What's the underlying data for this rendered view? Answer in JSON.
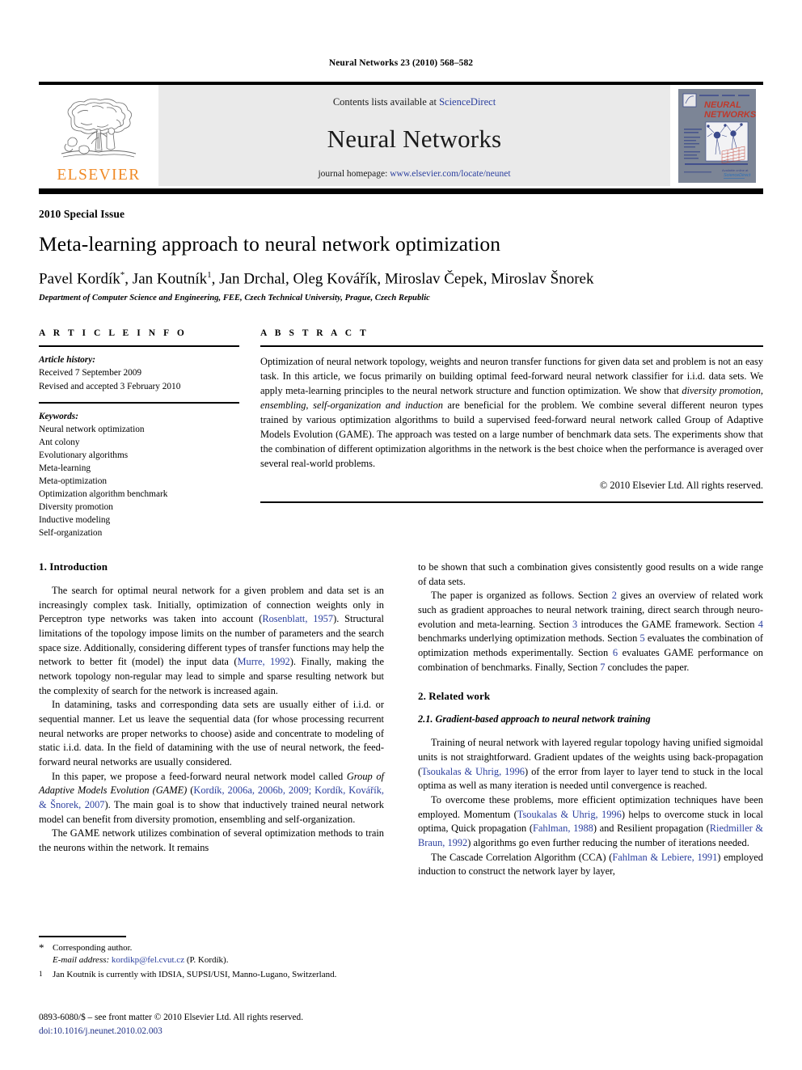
{
  "running_head": "Neural Networks 23 (2010) 568–582",
  "masthead": {
    "publisher_name": "ELSEVIER",
    "contents_prefix": "Contents lists available at ",
    "contents_link": "ScienceDirect",
    "journal_name": "Neural Networks",
    "homepage_prefix": "journal homepage: ",
    "homepage_url": "www.elsevier.com/locate/neunet",
    "cover_title_line1": "NEURAL",
    "cover_title_line2": "NETWORKS"
  },
  "title_block": {
    "special_issue": "2010 Special Issue",
    "title": "Meta-learning approach to neural network optimization",
    "affiliation": "Department of Computer Science and Engineering, FEE, Czech Technical University, Prague, Czech Republic"
  },
  "authors": [
    {
      "name": "Pavel Kordík",
      "mark": "*"
    },
    {
      "name": "Jan Koutník",
      "mark": "1"
    },
    {
      "name": "Jan Drchal",
      "mark": ""
    },
    {
      "name": "Oleg Kovářík",
      "mark": ""
    },
    {
      "name": "Miroslav Čepek",
      "mark": ""
    },
    {
      "name": "Miroslav Šnorek",
      "mark": ""
    }
  ],
  "article_info": {
    "label": "A R T I C L E    I N F O",
    "history_label": "Article history:",
    "history": [
      "Received 7 September 2009",
      "Revised and accepted 3 February 2010"
    ],
    "keywords_label": "Keywords:",
    "keywords": [
      "Neural network optimization",
      "Ant colony",
      "Evolutionary algorithms",
      "Meta-learning",
      "Meta-optimization",
      "Optimization algorithm benchmark",
      "Diversity promotion",
      "Inductive modeling",
      "Self-organization"
    ]
  },
  "abstract": {
    "label": "A B S T R A C T",
    "part1": "Optimization of neural network topology, weights and neuron transfer functions for given data set and problem is not an easy task. In this article, we focus primarily on building optimal feed-forward neural network classifier for i.i.d. data sets. We apply meta-learning principles to the neural network structure and function optimization. We show that ",
    "emphasis1": "diversity promotion, ensembling, self-organization and induction",
    "part2": " are beneficial for the problem. We combine several different neuron types trained by various optimization algorithms to build a supervised feed-forward neural network called Group of Adaptive Models Evolution (GAME). The approach was tested on a large number of benchmark data sets. The experiments show that the combination of different optimization algorithms in the network is the best choice when the performance is averaged over several real-world problems.",
    "copyright": "© 2010 Elsevier Ltd. All rights reserved."
  },
  "sections": {
    "introduction_heading": "1. Introduction",
    "intro_p1_a": "The search for optimal neural network for a given problem and data set is an increasingly complex task. Initially, optimization of connection weights only in Perceptron type networks was taken into account (",
    "intro_p1_cite1": "Rosenblatt, 1957",
    "intro_p1_b": "). Structural limitations of the topology impose limits on the number of parameters and the search space size. Additionally, considering different types of transfer functions may help the network to better fit (model) the input data (",
    "intro_p1_cite2": "Murre, 1992",
    "intro_p1_c": "). Finally, making the network topology non-regular may lead to simple and sparse resulting network but the complexity of search for the network is increased again.",
    "intro_p2": "In datamining, tasks and corresponding data sets are usually either of i.i.d. or sequential manner. Let us leave the sequential data (for whose processing recurrent neural networks are proper networks to choose) aside and concentrate to modeling of static i.i.d. data. In the field of datamining with the use of neural network, the feed-forward neural networks are usually considered.",
    "intro_p3_a": "In this paper, we propose a feed-forward neural network model called ",
    "intro_p3_em": "Group of Adaptive Models Evolution (GAME)",
    "intro_p3_b": " (",
    "intro_p3_cite": "Kordík, 2006a, 2006b, 2009; Kordík, Kovářík, & Šnorek, 2007",
    "intro_p3_c": "). The main goal is to show that inductively trained neural network model can benefit from diversity promotion, ensembling and self-organization.",
    "intro_p4": "The GAME network utilizes combination of several optimization methods to train the neurons within the network. It remains",
    "right_p1": "to be shown that such a combination gives consistently good results on a wide range of data sets.",
    "right_p2_a": "The paper is organized as follows. Section ",
    "right_p2_x1": "2",
    "right_p2_b": " gives an overview of related work such as gradient approaches to neural network training, direct search through neuro-evolution and meta-learning. Section ",
    "right_p2_x2": "3",
    "right_p2_c": " introduces the GAME framework. Section ",
    "right_p2_x3": "4",
    "right_p2_d": " benchmarks underlying optimization methods. Section ",
    "right_p2_x4": "5",
    "right_p2_e": " evaluates the combination of optimization methods experimentally. Section ",
    "right_p2_x5": "6",
    "right_p2_f": " evaluates GAME performance on combination of benchmarks. Finally, Section ",
    "right_p2_x6": "7",
    "right_p2_g": " concludes the paper.",
    "related_work_heading": "2. Related work",
    "subsec_heading": "2.1. Gradient-based approach to neural network training",
    "rw_p1_a": "Training of neural network with layered regular topology having unified sigmoidal units is not straightforward. Gradient updates of the weights using back-propagation (",
    "rw_p1_cite": "Tsoukalas & Uhrig, 1996",
    "rw_p1_b": ") of the error from layer to layer tend to stuck in the local optima as well as many iteration is needed until convergence is reached.",
    "rw_p2_a": "To overcome these problems, more efficient optimization techniques have been employed. Momentum (",
    "rw_p2_cite1": "Tsoukalas & Uhrig, 1996",
    "rw_p2_b": ") helps to overcome stuck in local optima, Quick propagation (",
    "rw_p2_cite2": "Fahlman, 1988",
    "rw_p2_c": ") and Resilient propagation (",
    "rw_p2_cite3": "Riedmiller & Braun, 1992",
    "rw_p2_d": ") algorithms go even further reducing the number of iterations needed.",
    "rw_p3_a": "The Cascade Correlation Algorithm (CCA) (",
    "rw_p3_cite": "Fahlman & Lebiere, 1991",
    "rw_p3_b": ") employed induction to construct the network layer by layer,"
  },
  "footnotes": {
    "star_mark": "*",
    "corresponding": "Corresponding author.",
    "email_label": "E-mail address:",
    "email": "kordikp@fel.cvut.cz",
    "email_suffix": "(P. Kordík).",
    "one_mark": "1",
    "note1": "Jan Koutník is currently with IDSIA, SUPSI/USI, Manno-Lugano, Switzerland."
  },
  "imprint": {
    "line1": "0893-6080/$ – see front matter © 2010 Elsevier Ltd. All rights reserved.",
    "doi": "doi:10.1016/j.neunet.2010.02.003"
  },
  "colors": {
    "link": "#2b3f9e",
    "elsevier_orange": "#f08a26",
    "masthead_bg": "#eaeaea",
    "cover_bg": "#7c8596",
    "cover_title": "#c0392b"
  }
}
